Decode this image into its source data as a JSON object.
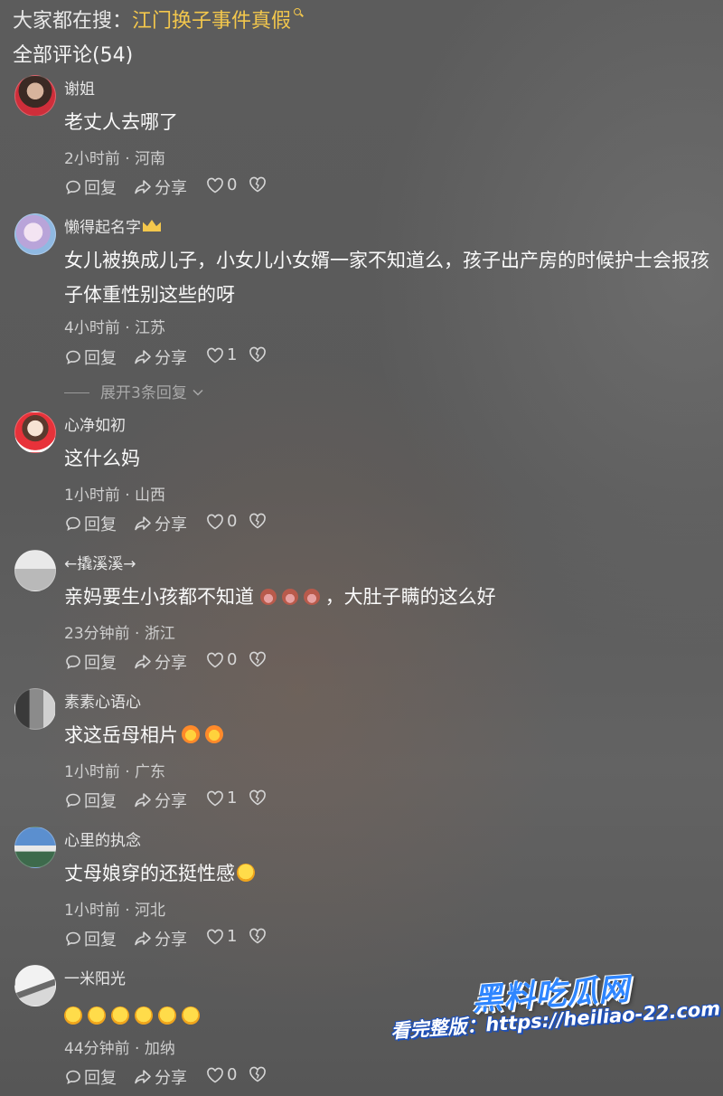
{
  "search": {
    "prefix": "大家都在搜：",
    "keyword": "江门换子事件真假"
  },
  "comments_header": {
    "label": "全部评论(54)"
  },
  "actions": {
    "reply": "回复",
    "share": "分享"
  },
  "comments": [
    {
      "author": "谢姐",
      "text": "老丈人去哪了",
      "meta": "2小时前 · 河南",
      "likes": "0"
    },
    {
      "author": "懒得起名字",
      "text": "女儿被换成儿子，小女儿小女婿一家不知道么，孩子出产房的时候护士会报孩子体重性别这些的呀",
      "meta": "4小时前 · 江苏",
      "likes": "1",
      "expand": "展开3条回复"
    },
    {
      "author": "心净如初",
      "text": "这什么妈",
      "meta": "1小时前 · 山西",
      "likes": "0"
    },
    {
      "author": "←撬溪溪→",
      "text_a": "亲妈要生小孩都不知道",
      "text_b": "，大肚子瞒的这么好",
      "meta": "23分钟前 · 浙江",
      "likes": "0"
    },
    {
      "author": "素素心语心",
      "text": "求这岳母相片",
      "meta": "1小时前 · 广东",
      "likes": "1"
    },
    {
      "author": "心里的执念",
      "text": "丈母娘穿的还挺性感",
      "meta": "1小时前 · 河北",
      "likes": "1"
    },
    {
      "author": "一米阳光",
      "meta": "44分钟前 · 加纳",
      "likes": "0"
    }
  ],
  "watermark": {
    "logo": "黑料吃瓜网",
    "url": "看完整版：https://heiliao-22.com"
  },
  "colors": {
    "accent_yellow": "#f3c74c",
    "watermark_blue": "#2f86ff"
  }
}
